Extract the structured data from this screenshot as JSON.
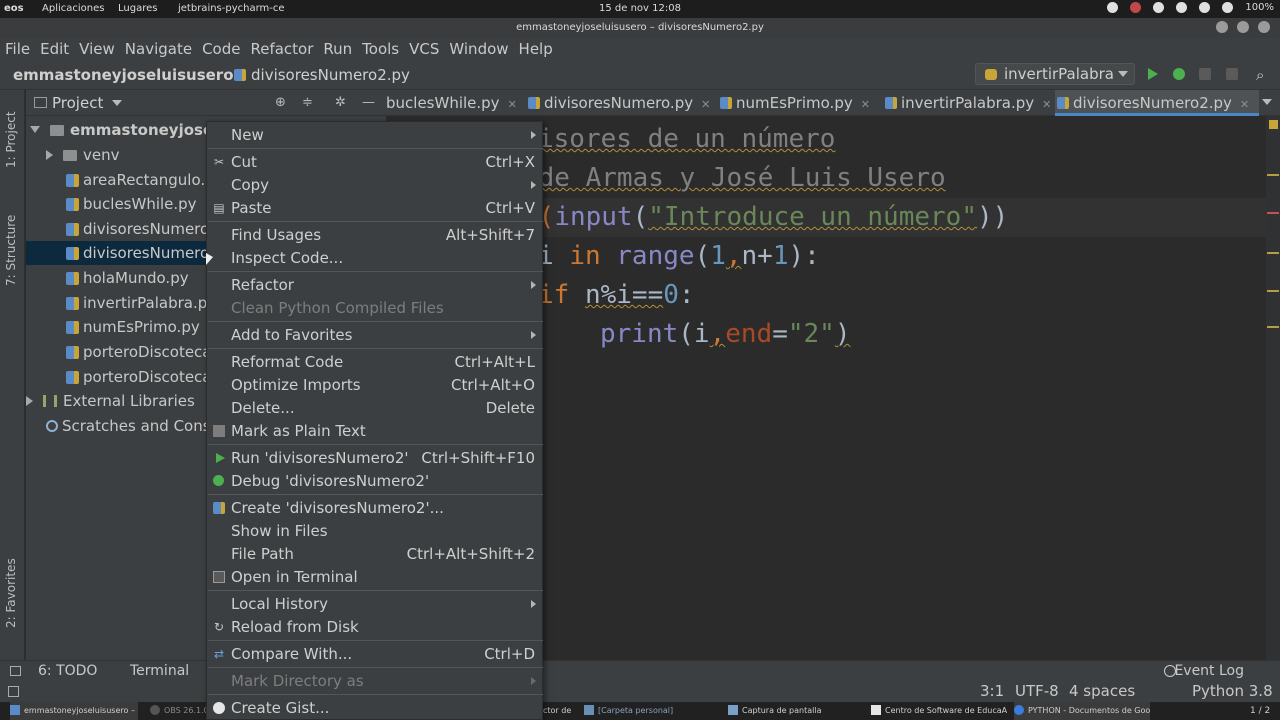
{
  "os": {
    "logo": "eos",
    "apps": "Aplicaciones",
    "places": "Lugares",
    "task": "jetbrains-pycharm-ce",
    "clock": "15 de nov 12:08",
    "battery": "100%"
  },
  "window": {
    "title": "emmastoneyjoseluisusero – divisoresNumero2.py"
  },
  "menubar": [
    "File",
    "Edit",
    "View",
    "Navigate",
    "Code",
    "Refactor",
    "Run",
    "Tools",
    "VCS",
    "Window",
    "Help"
  ],
  "navbar": {
    "project": "emmastoneyjoseluisusero",
    "file": "divisoresNumero2.py",
    "run_config": "invertirPalabra"
  },
  "left_stripe": {
    "project": "1: Project",
    "structure": "7: Structure",
    "favorites": "2: Favorites"
  },
  "project_panel": {
    "title": "Project",
    "tree": [
      {
        "label": "emmastoneyjoselu",
        "kind": "root"
      },
      {
        "label": "venv",
        "kind": "folder"
      },
      {
        "label": "areaRectangulo.p",
        "kind": "py"
      },
      {
        "label": "buclesWhile.py",
        "kind": "py"
      },
      {
        "label": "divisoresNumero",
        "kind": "py"
      },
      {
        "label": "divisoresNumero",
        "kind": "py",
        "selected": true
      },
      {
        "label": "holaMundo.py",
        "kind": "py"
      },
      {
        "label": "invertirPalabra.py",
        "kind": "py"
      },
      {
        "label": "numEsPrimo.py",
        "kind": "py"
      },
      {
        "label": "porteroDiscoteca",
        "kind": "py"
      },
      {
        "label": "porteroDiscoteca",
        "kind": "py"
      },
      {
        "label": "External Libraries",
        "kind": "lib"
      },
      {
        "label": "Scratches and Conso",
        "kind": "scratch"
      }
    ]
  },
  "editor": {
    "tabs": [
      {
        "label": "buclesWhile.py"
      },
      {
        "label": "divisoresNumero.py"
      },
      {
        "label": "numEsPrimo.py"
      },
      {
        "label": "invertirPalabra.py"
      },
      {
        "label": "divisoresNumero2.py",
        "active": true
      }
    ],
    "code": {
      "line1": "isores de un número",
      "line2": " de Armas y José Luis Usero",
      "line3_a": "t(",
      "line3_b": "input",
      "line3_c": "(",
      "line3_d": "\"Introduce un número\"",
      "line3_e": "))",
      "line4_a": "i ",
      "line4_b": "in ",
      "line4_c": "range",
      "line4_d": "(",
      "line4_e": "1",
      "line4_f": ",",
      "line4_g": "n+",
      "line4_h": "1",
      "line4_i": "):",
      "line5_a": "if ",
      "line5_b": "n%i==",
      "line5_c": "0",
      "line5_d": ":",
      "line6_a": "print",
      "line6_b": "(i",
      "line6_c": ",",
      "line6_d": "end",
      "line6_e": "=",
      "line6_f": "\"2\"",
      "line6_g": ")"
    }
  },
  "context_menu": {
    "items": [
      {
        "label": "New",
        "submenu": true
      },
      {
        "label": "Cut",
        "shortcut": "Ctrl+X",
        "icon": "scissors-icon"
      },
      {
        "label": "Copy",
        "submenu": true
      },
      {
        "label": "Paste",
        "shortcut": "Ctrl+V",
        "icon": "clipboard-icon"
      },
      {
        "label": "Find Usages",
        "shortcut": "Alt+Shift+7"
      },
      {
        "label": "Inspect Code..."
      },
      {
        "label": "Refactor",
        "submenu": true
      },
      {
        "label": "Clean Python Compiled Files",
        "disabled": true
      },
      {
        "label": "Add to Favorites",
        "submenu": true
      },
      {
        "label": "Reformat Code",
        "shortcut": "Ctrl+Alt+L"
      },
      {
        "label": "Optimize Imports",
        "shortcut": "Ctrl+Alt+O"
      },
      {
        "label": "Delete...",
        "shortcut": "Delete"
      },
      {
        "label": "Mark as Plain Text",
        "icon": "text-file-icon"
      },
      {
        "label": "Run 'divisoresNumero2'",
        "shortcut": "Ctrl+Shift+F10",
        "icon": "run-icon"
      },
      {
        "label": "Debug 'divisoresNumero2'",
        "icon": "debug-icon"
      },
      {
        "label": "Create 'divisoresNumero2'...",
        "icon": "python-icon"
      },
      {
        "label": "Show in Files"
      },
      {
        "label": "File Path",
        "shortcut": "Ctrl+Alt+Shift+2"
      },
      {
        "label": "Open in Terminal",
        "icon": "terminal-icon"
      },
      {
        "label": "Local History",
        "submenu": true
      },
      {
        "label": "Reload from Disk",
        "icon": "reload-icon"
      },
      {
        "label": "Compare With...",
        "shortcut": "Ctrl+D",
        "icon": "compare-icon"
      },
      {
        "label": "Mark Directory as",
        "disabled": true,
        "submenu": true
      },
      {
        "label": "Create Gist...",
        "icon": "github-icon"
      }
    ]
  },
  "bottom_bar": {
    "todo": "6: TODO",
    "terminal": "Terminal",
    "event_log": "Event Log"
  },
  "status_bar": {
    "position": "3:1",
    "encoding": "UTF-8",
    "indent": "4 spaces",
    "interpreter": "Python 3.8"
  },
  "taskbar": {
    "items": [
      {
        "label": "emmastoneyjoseluisusero – divis..."
      },
      {
        "label": "OBS 26.1.0"
      },
      {
        "label": "ctor de ..."
      },
      {
        "label": "[Carpeta personal]"
      },
      {
        "label": "Captura de pantalla"
      },
      {
        "label": "Centro de Software de EducaAndOS"
      },
      {
        "label": "PYTHON - Documentos de Google..."
      }
    ],
    "pager": "1 / 2"
  }
}
